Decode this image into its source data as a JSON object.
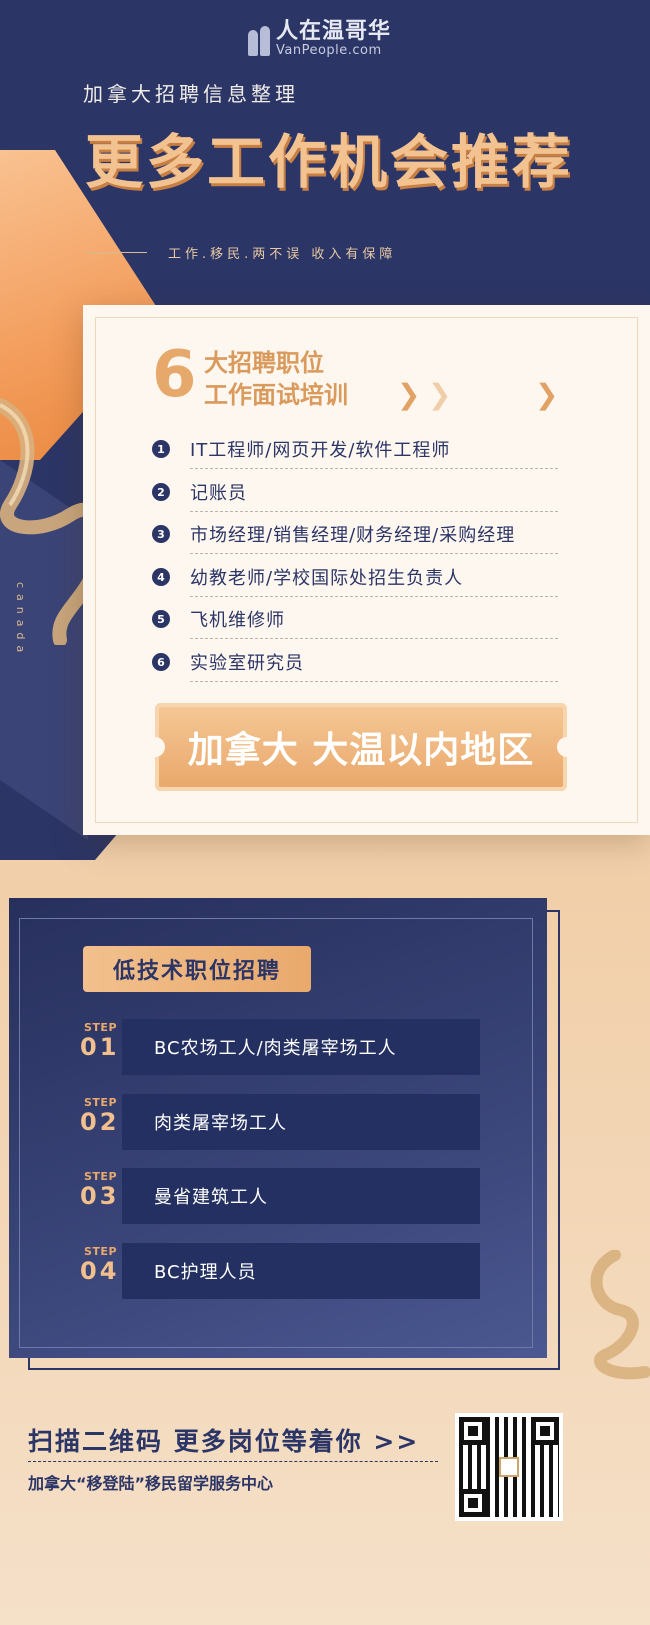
{
  "logo": {
    "cn": "人在温哥华",
    "en": "VanPeople.com"
  },
  "header": {
    "pre_title": "加拿大招聘信息整理",
    "title": "更多工作机会推荐",
    "tagline": "工作.移民.两不误 收入有保障",
    "side_text": "canada"
  },
  "card": {
    "number": "6",
    "head_line1": "大招聘职位",
    "head_line2": "工作面试培训",
    "jobs": [
      {
        "num": "1",
        "text": "IT工程师/网页开发/软件工程师"
      },
      {
        "num": "2",
        "text": "记账员"
      },
      {
        "num": "3",
        "text": "市场经理/销售经理/财务经理/采购经理"
      },
      {
        "num": "4",
        "text": "幼教老师/学校国际处招生负责人"
      },
      {
        "num": "5",
        "text": "飞机维修师"
      },
      {
        "num": "6",
        "text": "实验室研究员"
      }
    ],
    "region": "加拿大 大温以内地区"
  },
  "low_skill": {
    "title": "低技术职位招聘",
    "steps": [
      {
        "label": "STEP",
        "no": "01",
        "text": "BC农场工人/肉类屠宰场工人"
      },
      {
        "label": "STEP",
        "no": "02",
        "text": "肉类屠宰场工人"
      },
      {
        "label": "STEP",
        "no": "03",
        "text": "曼省建筑工人"
      },
      {
        "label": "STEP",
        "no": "04",
        "text": "BC护理人员"
      }
    ]
  },
  "footer": {
    "scan_text": "扫描二维码 更多岗位等着你 >>",
    "org": "加拿大“移登陆”移民留学服务中心"
  },
  "colors": {
    "navy": "#2b3566",
    "gold": "#e9a96c",
    "cream": "#fdf7f0"
  }
}
